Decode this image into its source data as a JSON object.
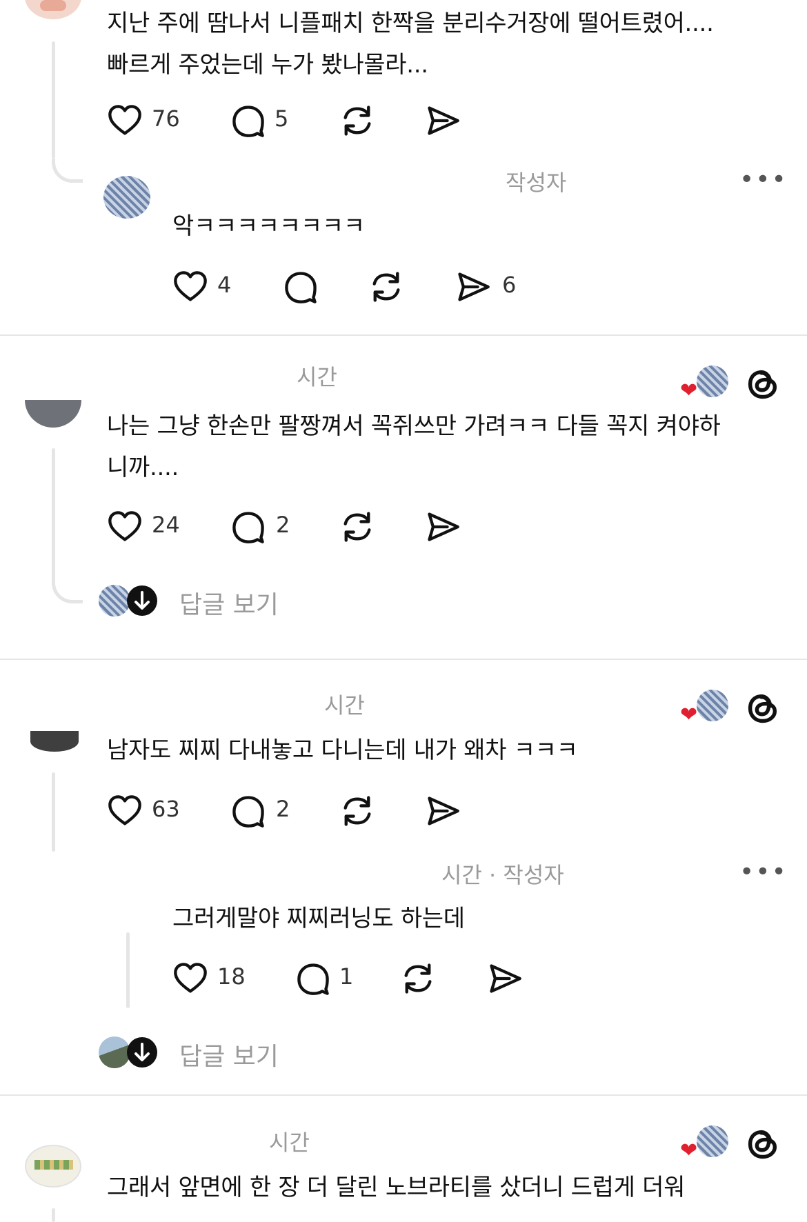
{
  "threads": [
    {
      "body": [
        "지난 주에 땀나서 니플패치 한짝을 분리수거장에 떨어트렸어....",
        "빠르게 주었는데 누가 봤나몰라..."
      ],
      "likes": "76",
      "comments": "5",
      "reply": {
        "meta": "작성자",
        "body": "악ㅋㅋㅋㅋㅋㅋㅋㅋ",
        "likes": "4",
        "shares": "6"
      }
    },
    {
      "meta": "시간",
      "body": [
        "나는 그냥 한손만 팔짱껴서 꼭쥐쓰만 가려ㅋㅋ 다들 꼭지 켜야하",
        "니까...."
      ],
      "likes": "24",
      "comments": "2",
      "view_replies": "답글 보기"
    },
    {
      "meta": "시간",
      "body": [
        "남자도 찌찌 다내놓고 다니는데 내가 왜차 ㅋㅋㅋ"
      ],
      "likes": "63",
      "comments": "2",
      "reply": {
        "meta": "시간 · 작성자",
        "body": "그러게말야 찌찌러닝도 하는데",
        "likes": "18",
        "comments": "1"
      },
      "view_replies": "답글 보기"
    },
    {
      "meta": "시간",
      "body": [
        "그래서 앞면에 한 장 더 달린 노브라티를 샀더니 드럽게 더워"
      ]
    }
  ],
  "icons": {
    "like": "heart-icon",
    "comment": "comment-icon",
    "repost": "repost-icon",
    "share": "send-icon",
    "more": "more-icon",
    "threads": "threads-logo-icon"
  },
  "colors": {
    "heart_badge": "#e0202e",
    "meta_text": "#9a9a9a"
  }
}
